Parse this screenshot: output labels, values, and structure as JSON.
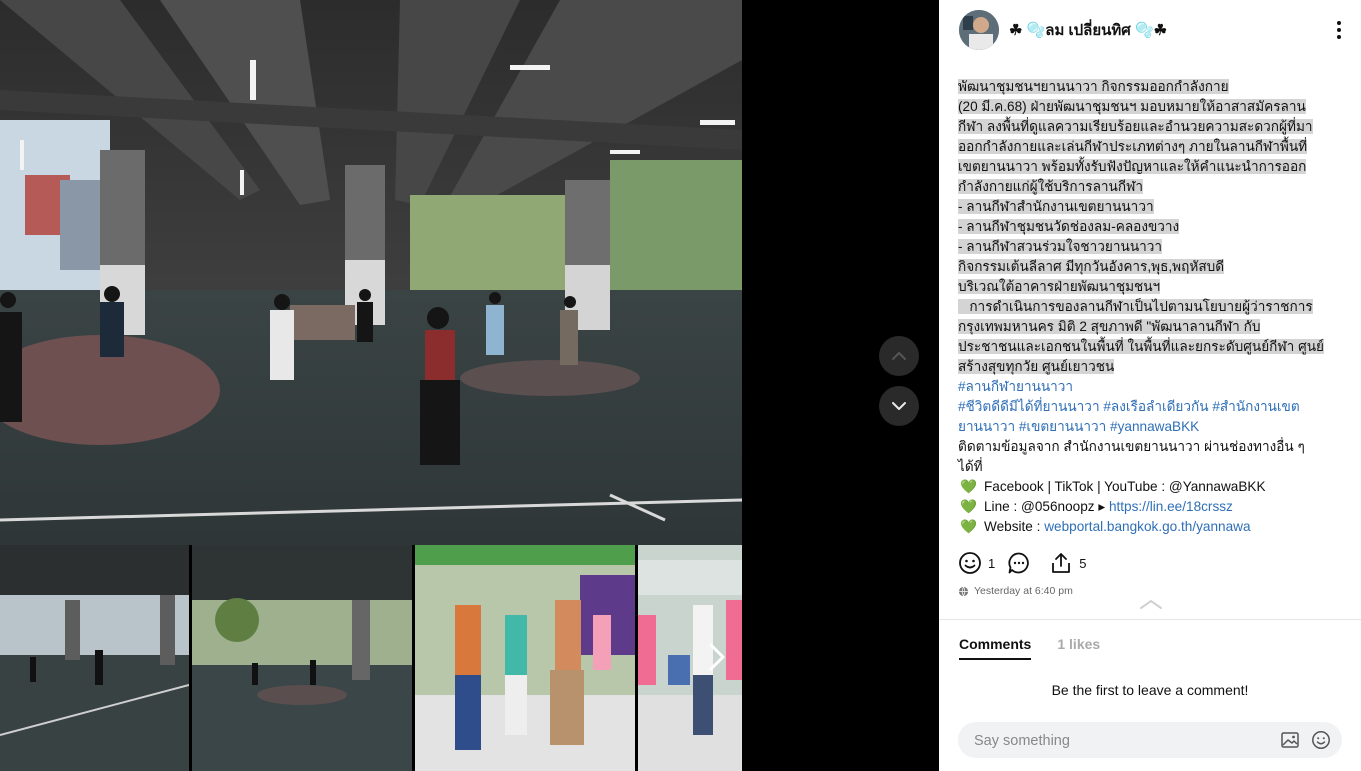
{
  "author": {
    "name": "☘ 🫧ลม เปลี่ยนทิศ 🫧☘"
  },
  "post": {
    "highlighted_lines": [
      "พัฒนาชุมชนฯยานนาวา กิจกรรมออกกำลังกาย",
      " (20 มี.ค.68)  ฝ่ายพัฒนาชุมชนฯ มอบหมายให้อาสาสมัครลาน",
      "กีฬา ลงพื้นที่ดูแลความเรียบร้อยและอำนวยความสะดวกผู้ที่มา",
      "ออกกำลังกายและเล่นกีฬาประเภทต่างๆ ภายในลานกีฬาพื้นที่",
      "เขตยานนาวา พร้อมทั้งรับฟังปัญหาและให้คำแนะนำการออก",
      "กำลังกายแก่ผู้ใช้บริการลานกีฬา",
      "- ลานกีฬาสำนักงานเขตยานนาวา",
      "- ลานกีฬาชุมชนวัดช่องลม-คลองขวาง",
      "- ลานกีฬาสวนร่วมใจชาวยานนาวา",
      "กิจกรรมเต้นลีลาศ มีทุกวันอังคาร,พุธ,พฤหัสบดี",
      "บริเวณใต้อาคารฝ่ายพัฒนาชุมชนฯ",
      "   การดำเนินการของลานกีฬาเป็นไปตามนโยบายผู้ว่าราชการ",
      "กรุงเทพมหานคร  มิติ 2 สุขภาพดี  \"พัฒนาลานกีฬา กับ",
      "ประชาชนและเอกชนในพื้นที่ ในพื้นที่และยกระดับศูนย์กีฬา ศูนย์",
      "สร้างสุขทุกวัย ศูนย์เยาวชน"
    ],
    "hashtag_line_1": "#ลานกีฬายานนาวา",
    "hashtag_line_2": "#ชีวิตดีดีมีได้ที่ยานนาวา #ลงเรือลำเดียวกัน #สำนักงานเขต",
    "hashtag_line_3": "ยานนาวา #เขตยานนาวา #yannawaBKK",
    "follow_line_1": "ติดตามข้อมูลจาก สำนักงานเขตยานนาวา ผ่านช่องทางอื่น ๆ",
    "follow_line_2": "ได้ที่",
    "heart": "💚",
    "channels": {
      "social": "Facebook | TikTok | YouTube : @YannawaBKK",
      "line_label": "Line : @056noopz ▸ ",
      "line_url": "https://lin.ee/18crssz",
      "website_label": "Website : ",
      "website_url": "webportal.bangkok.go.th/yannawa"
    }
  },
  "stats": {
    "reactions": "1",
    "shares": "5"
  },
  "timestamp": "Yesterday at 6:40 pm",
  "tabs": {
    "comments": "Comments",
    "likes": "1 likes"
  },
  "empty_comments": "Be the first to leave a comment!",
  "comment_input": {
    "placeholder": "Say something"
  },
  "icons": {
    "up": "chevron-up-icon",
    "down": "chevron-down-icon",
    "more": "more-vertical-icon",
    "smile": "smile-icon",
    "comment": "comment-icon",
    "share": "share-icon",
    "globe": "globe-icon",
    "image": "image-icon",
    "emoji": "emoji-icon",
    "next": "chevron-right-icon"
  }
}
